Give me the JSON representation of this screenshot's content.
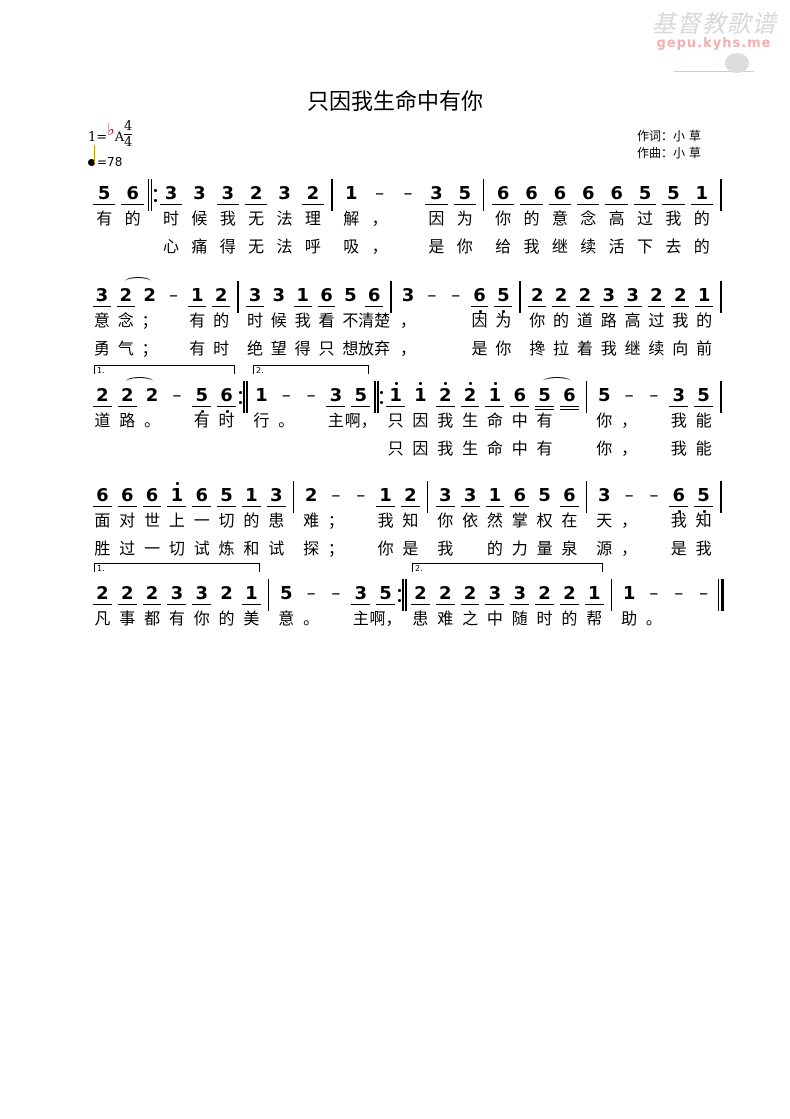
{
  "watermark": {
    "text": "基督教歌谱",
    "url": "gepu.kyhs.me"
  },
  "title": "只因我生命中有你",
  "key": {
    "prefix": "1=",
    "flat": "♭",
    "note": "A",
    "time_top": "4",
    "time_bottom": "4"
  },
  "tempo": {
    "value": "=78"
  },
  "credits": {
    "lyrics": "作词：小 草",
    "music": "作曲：小 草"
  },
  "systems": [
    {
      "measures": [
        {
          "cols": [
            {
              "n": "5",
              "u": 1,
              "l": [
                "有",
                ""
              ]
            },
            {
              "n": "6",
              "u": 1,
              "l": [
                "的",
                ""
              ]
            }
          ],
          "bar": "repeat-start"
        },
        {
          "cols": [
            {
              "n": "3",
              "u": 1,
              "l": [
                "时",
                "心"
              ]
            },
            {
              "n": "3",
              "l": [
                "候",
                "痛"
              ]
            },
            {
              "n": "3",
              "u": 1,
              "l": [
                "我",
                "得"
              ]
            },
            {
              "n": "2",
              "u": 1,
              "l": [
                "无",
                "无"
              ]
            },
            {
              "n": "3",
              "l": [
                "法",
                "法"
              ]
            },
            {
              "n": "2",
              "u": 1,
              "l": [
                "理",
                "呼"
              ]
            }
          ],
          "bar": "single"
        },
        {
          "cols": [
            {
              "n": "1",
              "l": [
                "解",
                "吸"
              ]
            },
            {
              "n": "–",
              "l": [
                "，",
                "，"
              ]
            },
            {
              "n": "–",
              "l": [
                "",
                ""
              ]
            },
            {
              "n": "3",
              "u": 1,
              "l": [
                "因",
                "是"
              ]
            },
            {
              "n": "5",
              "u": 1,
              "l": [
                "为",
                "你"
              ]
            }
          ],
          "bar": "single"
        },
        {
          "cols": [
            {
              "n": "6",
              "u": 1,
              "l": [
                "你",
                "给"
              ]
            },
            {
              "n": "6",
              "u": 1,
              "l": [
                "的",
                "我"
              ]
            },
            {
              "n": "6",
              "u": 1,
              "l": [
                "意",
                "继"
              ]
            },
            {
              "n": "6",
              "u": 1,
              "l": [
                "念",
                "续"
              ]
            },
            {
              "n": "6",
              "u": 1,
              "l": [
                "高",
                "活"
              ]
            },
            {
              "n": "5",
              "u": 1,
              "l": [
                "过",
                "下"
              ]
            },
            {
              "n": "5",
              "u": 1,
              "l": [
                "我",
                "去"
              ]
            },
            {
              "n": "1",
              "u": 1,
              "l": [
                "的",
                "的"
              ]
            }
          ],
          "bar": "single"
        }
      ]
    },
    {
      "measures": [
        {
          "cols": [
            {
              "n": "3",
              "u": 1,
              "l": [
                "意",
                "勇"
              ]
            },
            {
              "n": "2",
              "u": 1,
              "tie": 1,
              "l": [
                "念",
                "气"
              ]
            },
            {
              "n": "2",
              "l": [
                "；",
                "；"
              ]
            },
            {
              "n": "–",
              "l": [
                "",
                ""
              ]
            },
            {
              "n": "1",
              "u": 1,
              "l": [
                "有",
                "有"
              ]
            },
            {
              "n": "2",
              "u": 1,
              "l": [
                "的",
                "时"
              ]
            }
          ],
          "bar": "single"
        },
        {
          "cols": [
            {
              "n": "3",
              "u": 1,
              "l": [
                "时",
                "绝"
              ]
            },
            {
              "n": "3",
              "l": [
                "候",
                "望"
              ]
            },
            {
              "n": "1",
              "u": 1,
              "l": [
                "我",
                "得"
              ]
            },
            {
              "n": "6",
              "u": 1,
              "l": [
                "看",
                "只"
              ]
            },
            {
              "n": "5",
              "l": [
                "不",
                "想"
              ]
            },
            {
              "n": "6",
              "u": 1,
              "l": [
                "清楚",
                "放弃"
              ]
            }
          ],
          "bar": "single"
        },
        {
          "cols": [
            {
              "n": "3",
              "l": [
                "，",
                "，"
              ]
            },
            {
              "n": "–",
              "l": [
                "",
                ""
              ]
            },
            {
              "n": "–",
              "l": [
                "",
                ""
              ]
            },
            {
              "n": "6",
              "u": 1,
              "d": "below",
              "l": [
                "因",
                "是"
              ]
            },
            {
              "n": "5",
              "u": 1,
              "d": "below",
              "l": [
                "为",
                "你"
              ]
            }
          ],
          "bar": "single"
        },
        {
          "cols": [
            {
              "n": "2",
              "u": 1,
              "l": [
                "你",
                "搀"
              ]
            },
            {
              "n": "2",
              "u": 1,
              "l": [
                "的",
                "拉"
              ]
            },
            {
              "n": "2",
              "u": 1,
              "l": [
                "道",
                "着"
              ]
            },
            {
              "n": "3",
              "u": 1,
              "l": [
                "路",
                "我"
              ]
            },
            {
              "n": "3",
              "u": 1,
              "l": [
                "高",
                "继"
              ]
            },
            {
              "n": "2",
              "u": 1,
              "l": [
                "过",
                "续"
              ]
            },
            {
              "n": "2",
              "u": 1,
              "l": [
                "我",
                "向"
              ]
            },
            {
              "n": "1",
              "u": 1,
              "l": [
                "的",
                "前"
              ]
            }
          ],
          "bar": "single"
        }
      ]
    },
    {
      "measures": [
        {
          "volta": "1.",
          "cols": [
            {
              "n": "2",
              "u": 1,
              "l": [
                "道",
                ""
              ]
            },
            {
              "n": "2",
              "u": 1,
              "tie": 1,
              "l": [
                "路",
                ""
              ]
            },
            {
              "n": "2",
              "l": [
                "。",
                ""
              ]
            },
            {
              "n": "–",
              "l": [
                "",
                ""
              ]
            },
            {
              "n": "5",
              "u": 1,
              "d": "below",
              "l": [
                "有",
                ""
              ]
            },
            {
              "n": "6",
              "u": 1,
              "d": "below",
              "l": [
                "时",
                ""
              ]
            }
          ],
          "bar": "repeat-end"
        },
        {
          "volta": "2.",
          "cols": [
            {
              "n": "1",
              "l": [
                "行",
                ""
              ]
            },
            {
              "n": "–",
              "l": [
                "。",
                ""
              ]
            },
            {
              "n": "–",
              "l": [
                "",
                ""
              ]
            },
            {
              "n": "3",
              "u": 1,
              "l": [
                "主",
                ""
              ]
            },
            {
              "n": "5",
              "u": 1,
              "l": [
                "啊，",
                ""
              ]
            }
          ],
          "bar": "repeat-start"
        },
        {
          "cols": [
            {
              "n": "1",
              "u": 1,
              "d": "above",
              "l": [
                "只",
                "只"
              ]
            },
            {
              "n": "1",
              "d": "above",
              "l": [
                "因",
                "因"
              ]
            },
            {
              "n": "2",
              "u": 1,
              "d": "above",
              "l": [
                "我",
                "我"
              ]
            },
            {
              "n": "2",
              "u": 1,
              "d": "above",
              "l": [
                "生",
                "生"
              ]
            },
            {
              "n": "1",
              "u": 1,
              "d": "above",
              "l": [
                "命",
                "命"
              ]
            },
            {
              "n": "6",
              "u": 1,
              "l": [
                "中",
                "中"
              ]
            },
            {
              "n": "5",
              "u": 2,
              "tie": 1,
              "l": [
                "有",
                "有"
              ]
            },
            {
              "n": "6",
              "u": 2,
              "l": [
                "",
                ""
              ]
            }
          ],
          "bar": "single"
        },
        {
          "cols": [
            {
              "n": "5",
              "l": [
                "你",
                "你"
              ]
            },
            {
              "n": "–",
              "l": [
                "，",
                "，"
              ]
            },
            {
              "n": "–",
              "l": [
                "",
                ""
              ]
            },
            {
              "n": "3",
              "u": 1,
              "l": [
                "我",
                "我"
              ]
            },
            {
              "n": "5",
              "u": 1,
              "l": [
                "能",
                "能"
              ]
            }
          ],
          "bar": "single"
        }
      ]
    },
    {
      "measures": [
        {
          "cols": [
            {
              "n": "6",
              "u": 1,
              "l": [
                "面",
                "胜"
              ]
            },
            {
              "n": "6",
              "u": 1,
              "l": [
                "对",
                "过"
              ]
            },
            {
              "n": "6",
              "u": 1,
              "l": [
                "世",
                "一"
              ]
            },
            {
              "n": "1",
              "u": 1,
              "d": "above",
              "l": [
                "上",
                "切"
              ]
            },
            {
              "n": "6",
              "u": 1,
              "l": [
                "一",
                "试"
              ]
            },
            {
              "n": "5",
              "u": 1,
              "l": [
                "切",
                "炼"
              ]
            },
            {
              "n": "1",
              "u": 1,
              "l": [
                "的",
                "和"
              ]
            },
            {
              "n": "3",
              "u": 1,
              "l": [
                "患",
                "试"
              ]
            }
          ],
          "bar": "single"
        },
        {
          "cols": [
            {
              "n": "2",
              "l": [
                "难",
                "探"
              ]
            },
            {
              "n": "–",
              "l": [
                "；",
                "；"
              ]
            },
            {
              "n": "–",
              "l": [
                "",
                ""
              ]
            },
            {
              "n": "1",
              "u": 1,
              "l": [
                "我",
                "你"
              ]
            },
            {
              "n": "2",
              "u": 1,
              "l": [
                "知",
                "是"
              ]
            }
          ],
          "bar": "single"
        },
        {
          "cols": [
            {
              "n": "3",
              "u": 1,
              "l": [
                "你",
                "我"
              ]
            },
            {
              "n": "3",
              "u": 1,
              "l": [
                "依",
                ""
              ]
            },
            {
              "n": "1",
              "u": 1,
              "l": [
                "然",
                "的"
              ]
            },
            {
              "n": "6",
              "u": 1,
              "l": [
                "掌",
                "力"
              ]
            },
            {
              "n": "5",
              "l": [
                "权",
                "量"
              ]
            },
            {
              "n": "6",
              "u": 1,
              "l": [
                "在",
                "泉"
              ]
            }
          ],
          "bar": "single"
        },
        {
          "cols": [
            {
              "n": "3",
              "l": [
                "天",
                "源"
              ]
            },
            {
              "n": "–",
              "l": [
                "，",
                "，"
              ]
            },
            {
              "n": "–",
              "l": [
                "",
                ""
              ]
            },
            {
              "n": "6",
              "u": 1,
              "d": "below",
              "l": [
                "我",
                "是"
              ]
            },
            {
              "n": "5",
              "u": 1,
              "d": "below",
              "l": [
                "知",
                "我"
              ]
            }
          ],
          "bar": "single"
        }
      ]
    },
    {
      "measures": [
        {
          "volta": "1.",
          "cols": [
            {
              "n": "2",
              "u": 1,
              "l": [
                "凡",
                ""
              ]
            },
            {
              "n": "2",
              "u": 1,
              "l": [
                "事",
                ""
              ]
            },
            {
              "n": "2",
              "u": 1,
              "l": [
                "都",
                ""
              ]
            },
            {
              "n": "3",
              "u": 1,
              "l": [
                "有",
                ""
              ]
            },
            {
              "n": "3",
              "u": 1,
              "l": [
                "你",
                ""
              ]
            },
            {
              "n": "2",
              "l": [
                "的",
                ""
              ]
            },
            {
              "n": "1",
              "u": 1,
              "l": [
                "美",
                ""
              ]
            }
          ],
          "bar": "single"
        },
        {
          "cols": [
            {
              "n": "5",
              "l": [
                "意",
                ""
              ]
            },
            {
              "n": "–",
              "l": [
                "。",
                ""
              ]
            },
            {
              "n": "–",
              "l": [
                "",
                ""
              ]
            },
            {
              "n": "3",
              "u": 1,
              "l": [
                "主",
                ""
              ]
            },
            {
              "n": "5",
              "u": 1,
              "l": [
                "啊，",
                ""
              ]
            }
          ],
          "bar": "repeat-end"
        },
        {
          "volta": "2.",
          "cols": [
            {
              "n": "2",
              "u": 1,
              "l": [
                "患",
                ""
              ]
            },
            {
              "n": "2",
              "u": 1,
              "l": [
                "难",
                ""
              ]
            },
            {
              "n": "2",
              "u": 1,
              "l": [
                "之",
                ""
              ]
            },
            {
              "n": "3",
              "u": 1,
              "l": [
                "中",
                ""
              ]
            },
            {
              "n": "3",
              "u": 1,
              "l": [
                "随",
                ""
              ]
            },
            {
              "n": "2",
              "u": 1,
              "l": [
                "时",
                ""
              ]
            },
            {
              "n": "2",
              "u": 1,
              "l": [
                "的",
                ""
              ]
            },
            {
              "n": "1",
              "u": 1,
              "l": [
                "帮",
                ""
              ]
            }
          ],
          "bar": "single"
        },
        {
          "cols": [
            {
              "n": "1",
              "l": [
                "助",
                ""
              ]
            },
            {
              "n": "–",
              "l": [
                "。",
                ""
              ]
            },
            {
              "n": "–",
              "l": [
                "",
                ""
              ]
            },
            {
              "n": "–",
              "l": [
                "",
                ""
              ]
            }
          ],
          "bar": "final"
        }
      ]
    }
  ]
}
